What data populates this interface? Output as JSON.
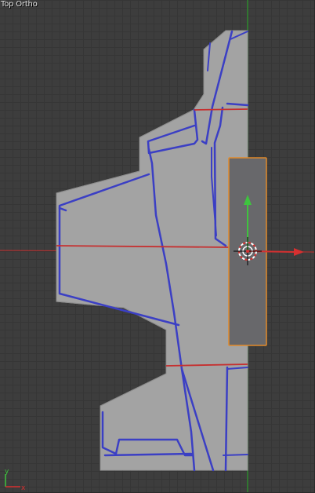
{
  "viewport": {
    "view_label": "Top Ortho",
    "axis_labels": {
      "y": "y",
      "x": "x"
    }
  },
  "colors": {
    "background": "#3d3d3d",
    "grid": "#363636",
    "mesh_fill": "#a3a3a3",
    "mesh_edges": "#3b3fc4",
    "x_axis": "#c62f2f",
    "y_axis": "#2f8a2f",
    "selection_outline": "#e28a2a",
    "selected_object_fill": "#68686b"
  },
  "icons": {
    "transform_manipulator": "transform-gizmo-icon",
    "cursor_3d": "3d-cursor-icon"
  }
}
